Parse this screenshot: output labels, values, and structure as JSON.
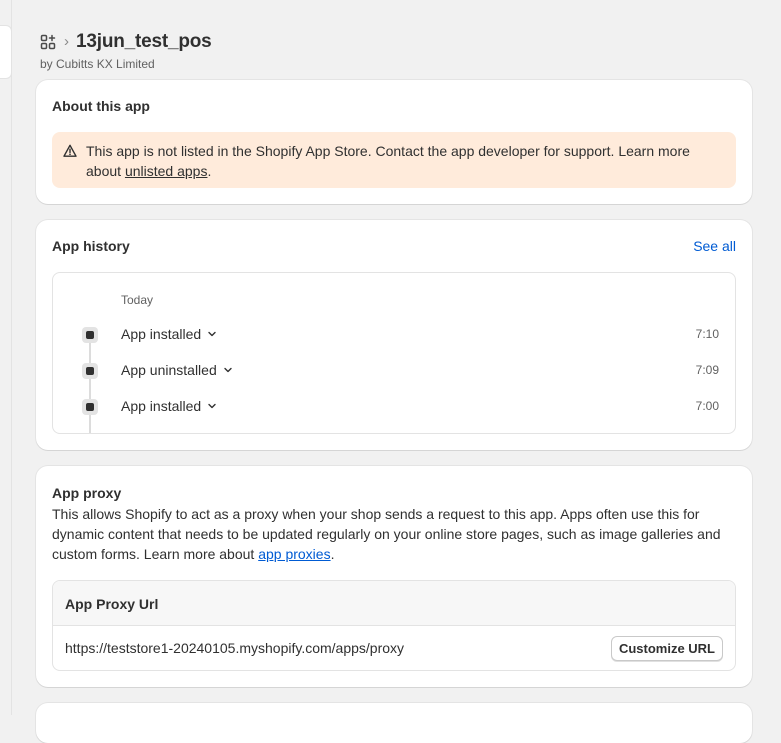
{
  "header": {
    "breadcrumb_icon": "apps-icon",
    "title": "13jun_test_pos",
    "byline": "by Cubitts KX Limited"
  },
  "about": {
    "title": "About this app",
    "banner_text": "This app is not listed in the Shopify App Store. Contact the app developer for support. Learn more about",
    "banner_link": "unlisted apps",
    "banner_end": ".",
    "banner_icon": "warning-triangle-icon"
  },
  "history": {
    "title": "App history",
    "see_all": "See all",
    "day": "Today",
    "events": [
      {
        "label": "App installed",
        "time": "7:10"
      },
      {
        "label": "App uninstalled",
        "time": "7:09"
      },
      {
        "label": "App installed",
        "time": "7:00"
      }
    ]
  },
  "proxy": {
    "title": "App proxy",
    "description": "This allows Shopify to act as a proxy when your shop sends a request to this app. Apps often use this for dynamic content that needs to be updated regularly on your online store pages, such as image galleries and custom forms. Learn more about",
    "link": "app proxies",
    "link_end": ".",
    "url_header": "App Proxy Url",
    "url": "https://teststore1-20240105.myshopify.com/apps/proxy",
    "customize_button": "Customize URL"
  },
  "colors": {
    "link": "#005bd3",
    "banner_bg": "#ffebdb",
    "page_bg": "#f1f1f1"
  }
}
